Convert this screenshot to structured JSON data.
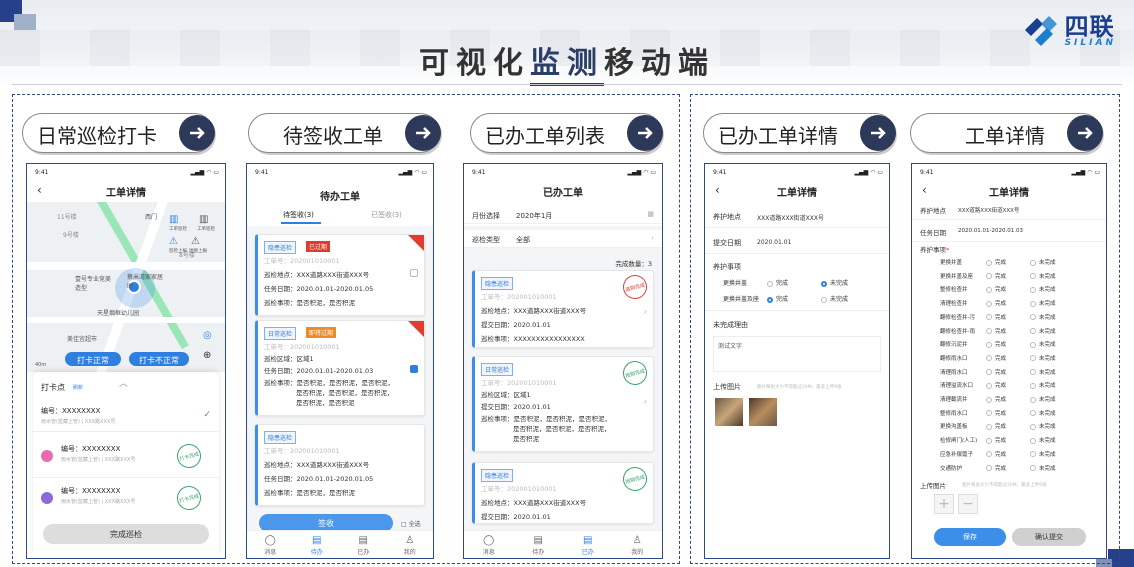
{
  "page_title": "可视化监测移动端",
  "title_highlight": "监测",
  "logo": {
    "cn": "四联",
    "en": "SILIAN"
  },
  "pills": [
    "日常巡检打卡",
    "待签收工单",
    "已办工单列表",
    "已办工单详情",
    "工单详情"
  ],
  "status_time": "9:41",
  "phone1": {
    "header": "工单详情",
    "map_labels": [
      "西门",
      "11号楼",
      "9号楼",
      "8号楼",
      "蔡米湾家家居时",
      "壹号专业竞美造型",
      "天星烟框幼儿园",
      "美佳宜超市",
      "40m"
    ],
    "map_side_labels": [
      "工单巡检",
      "工单巡检",
      "巡检上报",
      "地图上报"
    ],
    "btn_normal": "打卡正常",
    "btn_abnormal": "打卡不正常",
    "checkin_title": "打卡点",
    "checkin_sub": "刷新",
    "items": [
      {
        "code": "编号：XXXXXXXX",
        "addr": "雨水管(蓝藏上管) | XXX路XXX号"
      },
      {
        "code": "编号：XXXXXXXX",
        "addr": "雨水管(蓝藏上管) | XXX路XXX号"
      },
      {
        "code": "编号：XXXXXXXX",
        "addr": "雨水管(蓝藏上管) | XXX路XXX号"
      }
    ],
    "stamp": "打卡完成",
    "finish": "完成巡检"
  },
  "phone2": {
    "header": "待办工单",
    "tabs": [
      "待签收(3)",
      "已签收(3)"
    ],
    "cards": [
      {
        "tag": "隐患巡检",
        "tag2": "已过期",
        "no": "工单号：202001010001",
        "l1": "巡检地点：XXX道路XXX街道XXX号",
        "l2": "任务日期：2020.01.01-2020.01.05",
        "l3": "巡检事项：是否积泥，是否积泥"
      },
      {
        "tag": "日常巡检",
        "tag2": "即将过期",
        "no": "工单号：202001010001",
        "l1": "巡检区域：区域1",
        "l2": "任务日期：2020.01.01-2020.01.03",
        "l3": "巡检事项：是否积泥，是否积泥，是否积泥，",
        "l4": "是否积泥，是否积泥，是否积泥，",
        "l5": "是否积泥，是否积泥"
      },
      {
        "tag": "隐患巡检",
        "no": "工单号：202001010001",
        "l1": "巡检地点：XXX道路XXX街道XXX号",
        "l2": "任务日期：2020.01.01-2020.01.05",
        "l3": "巡检事项：是否积泥，是否积泥"
      }
    ],
    "sign": "签收",
    "select_all": "全选",
    "nav": [
      "消息",
      "待办",
      "已办",
      "我的"
    ]
  },
  "phone3": {
    "header": "已办工单",
    "month_label": "月份选择",
    "month_value": "2020年1月",
    "type_label": "巡检类型",
    "type_value": "全部",
    "count": "完成数量：3",
    "cards": [
      {
        "tag": "隐患巡检",
        "no": "工单号：202001010001",
        "l1": "巡检地点：XXX道路XXX街道XXX号",
        "l2": "提交日期：2020.01.01",
        "l3": "巡检事项：XXXXXXXXXXXXXXXX",
        "stamp": "逾期完成"
      },
      {
        "tag": "日常巡检",
        "no": "工单号：202001010001",
        "l1": "巡检区域：区域1",
        "l2": "提交日期：2020.01.01",
        "l3": "巡检事项：是否积泥，是否积泥，是否积泥，",
        "l4": "是否积泥，是否积泥，是否积泥，",
        "l5": "是否积泥",
        "stamp": "按期完成"
      },
      {
        "tag": "隐患巡检",
        "no": "工单号：202001010001",
        "l1": "巡检地点：XXX道路XXX街道XXX号",
        "l2": "提交日期：2020.01.01",
        "stamp": "按期完成"
      }
    ],
    "nav": [
      "消息",
      "待办",
      "已办",
      "我的"
    ]
  },
  "phone4": {
    "header": "工单详情",
    "site_k": "养护地点",
    "site_v": "XXX道路XXX街道XXX号",
    "date_k": "提交日期",
    "date_v": "2020.01.01",
    "items_title": "养护事项",
    "items": [
      {
        "name": "更换井盖",
        "a": "完成",
        "b": "未完成"
      },
      {
        "name": "更换井盖及座",
        "a": "完成",
        "b": "未完成"
      }
    ],
    "reason_title": "未完成理由",
    "reason_text": "测试文字",
    "upload_title": "上传图片",
    "upload_hint": "图片每张大小不得超过20M，最多上传9张"
  },
  "phone5": {
    "header": "工单详情",
    "site_k": "养护地点",
    "site_v": "XXX道路XXX街道XXX号",
    "date_k": "任务日期",
    "date_v": "2020.01.01-2020.01.03",
    "items_title": "养护事项",
    "items": [
      "更换井盖",
      "更换井盖及座",
      "整修检查井",
      "清理检查井",
      "翻修检查井-污",
      "翻修检查井-雨",
      "翻修沉泥井",
      "翻修雨水口",
      "清理雨水口",
      "清理溢流水口",
      "清理截流井",
      "整修雨水口",
      "更换沟盖板",
      "检修闸门(人工)",
      "应急补偿篦子",
      "交通防护"
    ],
    "opt_a": "完成",
    "opt_b": "未完成",
    "upload_title": "上传图片",
    "upload_hint": "图片每张大小不得超过20M，最多上传9张",
    "save": "保存",
    "submit": "确认提交"
  }
}
